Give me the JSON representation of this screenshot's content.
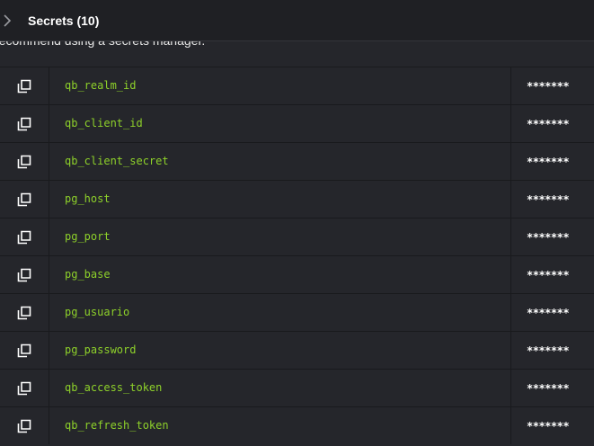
{
  "section": {
    "title": "Secrets (10)",
    "hint": "recommend using a secrets manager."
  },
  "secrets": [
    {
      "name": "qb_realm_id",
      "value": "*******"
    },
    {
      "name": "qb_client_id",
      "value": "*******"
    },
    {
      "name": "qb_client_secret",
      "value": "*******"
    },
    {
      "name": "pg_host",
      "value": "*******"
    },
    {
      "name": "pg_port",
      "value": "*******"
    },
    {
      "name": "pg_base",
      "value": "*******"
    },
    {
      "name": "pg_usuario",
      "value": "*******"
    },
    {
      "name": "pg_password",
      "value": "*******"
    },
    {
      "name": "qb_access_token",
      "value": "*******"
    },
    {
      "name": "qb_refresh_token",
      "value": "*******"
    }
  ],
  "colors": {
    "accent": "#8ed12a",
    "background": "#25262b",
    "header": "#1f2024"
  },
  "icons": {
    "toggle": "chevron-right-icon",
    "copy": "copy-icon"
  }
}
